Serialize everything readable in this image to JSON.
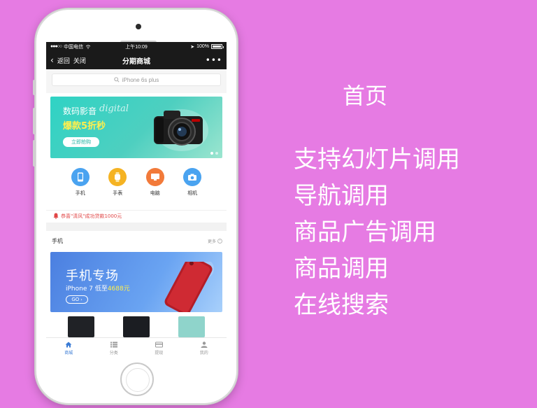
{
  "colors": {
    "background": "#e67be3",
    "banner_green": "#2fd3c4",
    "promo_blue": "#4b7fe0",
    "accent_red": "#e14646",
    "tab_active": "#3a7bd5"
  },
  "status_bar": {
    "carrier": "中国电信",
    "time": "上午10:09",
    "battery": "100%",
    "battery_level": 1.0
  },
  "navbar": {
    "back_label": "返回",
    "close_label": "关闭",
    "title": "分期商城",
    "more_label": "•••"
  },
  "search": {
    "placeholder": "iPhone 6s plus"
  },
  "banner": {
    "line1": "数码影音",
    "script": "digital",
    "line2": "爆款5折秒",
    "button": "立即抢购",
    "slide_count": 2,
    "active_slide": 1
  },
  "categories": [
    {
      "label": "手机",
      "icon": "phone-icon",
      "color": "#4aa3f0"
    },
    {
      "label": "手表",
      "icon": "watch-icon",
      "color": "#f5b323"
    },
    {
      "label": "电脑",
      "icon": "computer-icon",
      "color": "#f27a3a"
    },
    {
      "label": "相机",
      "icon": "camera-icon",
      "color": "#4aa3f0"
    }
  ],
  "notice": {
    "text": "恭喜\"清风\"成功贷款1000元"
  },
  "section": {
    "title": "手机",
    "more": "更多"
  },
  "promo": {
    "title": "手机专场",
    "subtitle_prefix": "iPhone 7 低至",
    "subtitle_price": "4688元",
    "go": "GO"
  },
  "tabbar": [
    {
      "label": "商城",
      "icon": "home-icon",
      "active": true
    },
    {
      "label": "分类",
      "icon": "list-icon",
      "active": false
    },
    {
      "label": "提现",
      "icon": "card-icon",
      "active": false
    },
    {
      "label": "我的",
      "icon": "user-icon",
      "active": false
    }
  ],
  "right_panel": {
    "heading": "首页",
    "features": [
      "支持幻灯片调用",
      "导航调用",
      "商品广告调用",
      "商品调用",
      "在线搜索"
    ]
  }
}
